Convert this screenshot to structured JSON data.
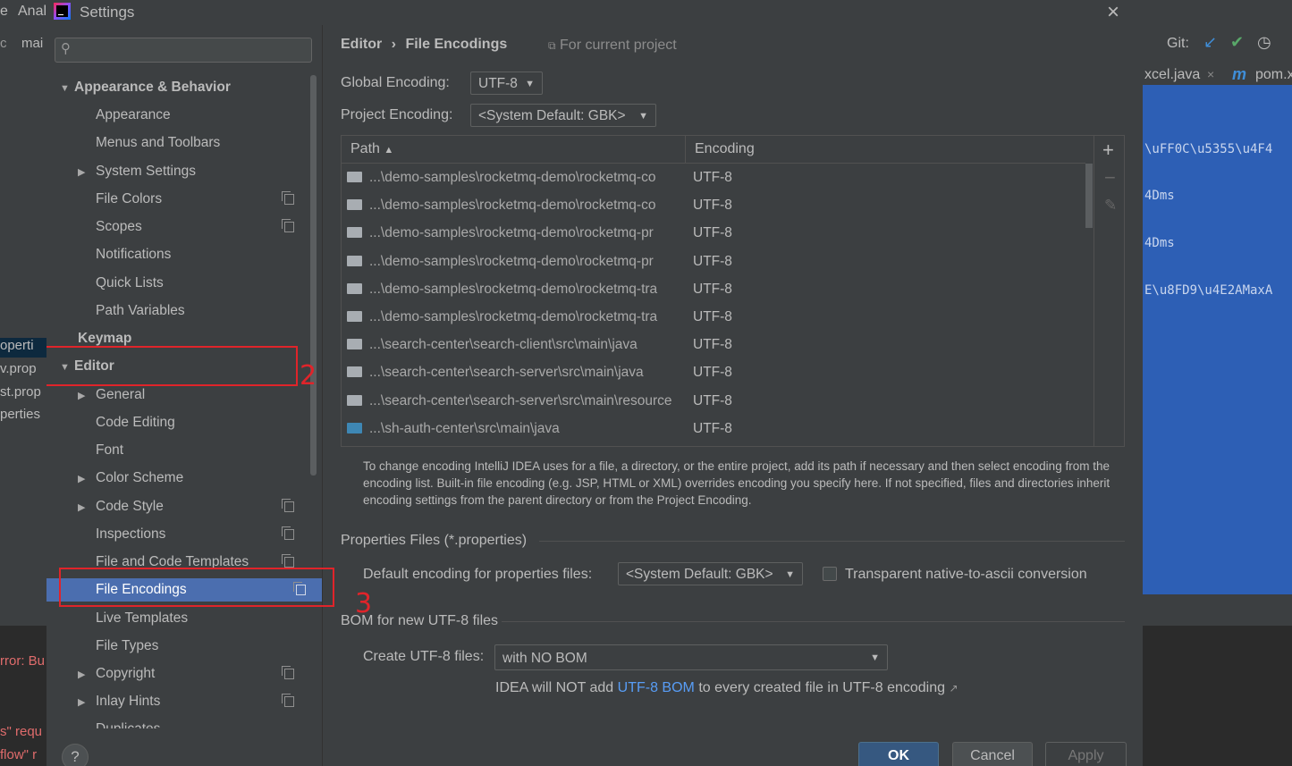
{
  "background_ide": {
    "left_fragments": [
      "e",
      "Anal",
      "c",
      "mai",
      "operti",
      "v.prop",
      "st.prop",
      "perties",
      "rror: Bu",
      "s\" requ",
      "flow\" r"
    ],
    "tabs": [
      "xcel.java",
      "pom.x"
    ],
    "git_label": "Git:",
    "code_lines": [
      "\\uFF0C\\u5355\\u4F4",
      "4Dms",
      "4Dms",
      "E\\u8FD9\\u4E2AMaxA"
    ]
  },
  "dialog": {
    "title": "Settings",
    "search_placeholder": "",
    "sidebar": {
      "items": [
        {
          "label": "Appearance & Behavior"
        },
        {
          "label": "Appearance"
        },
        {
          "label": "Menus and Toolbars"
        },
        {
          "label": "System Settings"
        },
        {
          "label": "File Colors"
        },
        {
          "label": "Scopes"
        },
        {
          "label": "Notifications"
        },
        {
          "label": "Quick Lists"
        },
        {
          "label": "Path Variables"
        },
        {
          "label": "Keymap"
        },
        {
          "label": "Editor"
        },
        {
          "label": "General"
        },
        {
          "label": "Code Editing"
        },
        {
          "label": "Font"
        },
        {
          "label": "Color Scheme"
        },
        {
          "label": "Code Style"
        },
        {
          "label": "Inspections"
        },
        {
          "label": "File and Code Templates"
        },
        {
          "label": "File Encodings"
        },
        {
          "label": "Live Templates"
        },
        {
          "label": "File Types"
        },
        {
          "label": "Copyright"
        },
        {
          "label": "Inlay Hints"
        },
        {
          "label": "Duplicates"
        }
      ]
    },
    "breadcrumb": {
      "parent": "Editor",
      "separator": "›",
      "current": "File Encodings",
      "scope": "For current project"
    },
    "global_encoding": {
      "label": "Global Encoding:",
      "value": "UTF-8"
    },
    "project_encoding": {
      "label": "Project Encoding:",
      "value": "<System Default: GBK>"
    },
    "table": {
      "col_path": "Path",
      "col_encoding": "Encoding",
      "rows": [
        {
          "path": "...\\demo-samples\\rocketmq-demo\\rocketmq-co",
          "encoding": "UTF-8"
        },
        {
          "path": "...\\demo-samples\\rocketmq-demo\\rocketmq-co",
          "encoding": "UTF-8"
        },
        {
          "path": "...\\demo-samples\\rocketmq-demo\\rocketmq-pr",
          "encoding": "UTF-8"
        },
        {
          "path": "...\\demo-samples\\rocketmq-demo\\rocketmq-pr",
          "encoding": "UTF-8"
        },
        {
          "path": "...\\demo-samples\\rocketmq-demo\\rocketmq-tra",
          "encoding": "UTF-8"
        },
        {
          "path": "...\\demo-samples\\rocketmq-demo\\rocketmq-tra",
          "encoding": "UTF-8"
        },
        {
          "path": "...\\search-center\\search-client\\src\\main\\java",
          "encoding": "UTF-8"
        },
        {
          "path": "...\\search-center\\search-server\\src\\main\\java",
          "encoding": "UTF-8"
        },
        {
          "path": "...\\search-center\\search-server\\src\\main\\resource",
          "encoding": "UTF-8"
        },
        {
          "path": "...\\sh-auth-center\\src\\main\\java",
          "encoding": "UTF-8"
        }
      ]
    },
    "help_text": "To change encoding IntelliJ IDEA uses for a file, a directory, or the entire project, add its path if necessary and then select encoding from the encoding list. Built-in file encoding (e.g. JSP, HTML or XML) overrides encoding you specify here. If not specified, files and directories inherit encoding settings from the parent directory or from the Project Encoding.",
    "properties_section": {
      "title": "Properties Files (*.properties)",
      "default_label": "Default encoding for properties files:",
      "default_value": "<System Default: GBK>",
      "transparent_label": "Transparent native-to-ascii conversion"
    },
    "bom_section": {
      "title": "BOM for new UTF-8 files",
      "create_label": "Create UTF-8 files:",
      "create_value": "with NO BOM",
      "note_prefix": "IDEA will NOT add",
      "note_link": "UTF-8 BOM",
      "note_suffix": "to every created file in UTF-8 encoding"
    },
    "buttons": {
      "ok": "OK",
      "cancel": "Cancel",
      "apply": "Apply",
      "help": "?"
    }
  },
  "annotations": {
    "box2": "2",
    "box3": "3"
  },
  "colors": {
    "selection": "#4b6eaf",
    "link": "#589df6",
    "annotation": "#e0242a"
  }
}
